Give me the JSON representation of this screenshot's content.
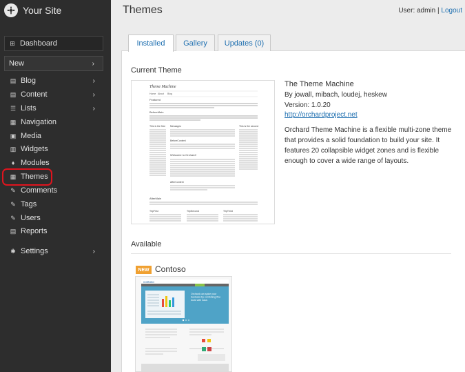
{
  "site": {
    "name": "Your Site"
  },
  "sidebar": {
    "dashboard": "Dashboard",
    "new": "New",
    "items": [
      {
        "label": "Blog",
        "icon": "blog-icon",
        "has_submenu": true
      },
      {
        "label": "Content",
        "icon": "content-icon",
        "has_submenu": true
      },
      {
        "label": "Lists",
        "icon": "lists-icon",
        "has_submenu": true
      },
      {
        "label": "Navigation",
        "icon": "navigation-icon",
        "has_submenu": false
      },
      {
        "label": "Media",
        "icon": "media-icon",
        "has_submenu": false
      },
      {
        "label": "Widgets",
        "icon": "widgets-icon",
        "has_submenu": false
      },
      {
        "label": "Modules",
        "icon": "modules-icon",
        "has_submenu": false
      },
      {
        "label": "Themes",
        "icon": "themes-icon",
        "has_submenu": false,
        "selected": true
      },
      {
        "label": "Comments",
        "icon": "comments-icon",
        "has_submenu": false
      },
      {
        "label": "Tags",
        "icon": "tags-icon",
        "has_submenu": false
      },
      {
        "label": "Users",
        "icon": "users-icon",
        "has_submenu": false
      },
      {
        "label": "Reports",
        "icon": "reports-icon",
        "has_submenu": false
      }
    ],
    "settings": "Settings"
  },
  "header": {
    "title": "Themes",
    "user_label": "User: admin",
    "separator": "|",
    "logout": "Logout"
  },
  "tabs": [
    {
      "label": "Installed",
      "active": true
    },
    {
      "label": "Gallery",
      "active": false
    },
    {
      "label": "Updates (0)",
      "active": false
    }
  ],
  "current_theme": {
    "section_title": "Current Theme",
    "name": "The Theme Machine",
    "authors": "By jowall, mibach, loudej, heskew",
    "version": "Version: 1.0.20",
    "url": "http://orchardproject.net",
    "description": "Orchard Theme Machine is a flexible multi-zone theme that provides a solid foundation to build your site. It features 20 collapsible widget zones and is flexible enough to cover a wide range of layouts.",
    "preview": {
      "site_title": "Theme Machine",
      "nav": [
        "Home",
        "About",
        "Blog"
      ],
      "featured": "Featured",
      "before_main": "BeforeMain",
      "aside_first": "This is the first",
      "messages": "Messages",
      "before_content": "BeforeContent",
      "aside_second": "This is the second",
      "welcome_title": "Welcome to Orchard!",
      "after_content": "AfterContent",
      "after_main": "AfterMain",
      "triptych": [
        "TripFirst",
        "TripSecond",
        "TripThird"
      ]
    }
  },
  "available": {
    "section_title": "Available",
    "themes": [
      {
        "name": "Contoso",
        "badge": "NEW",
        "preview": {
          "logo": "contoso",
          "hero_text": "Orchard can spice your business by combining fine tools with ease."
        }
      }
    ]
  },
  "colors": {
    "sidebar_bg": "#2d2d2d",
    "link": "#1e6fb0",
    "badge_new": "#f0a030",
    "highlight_ring": "#e0141e"
  }
}
